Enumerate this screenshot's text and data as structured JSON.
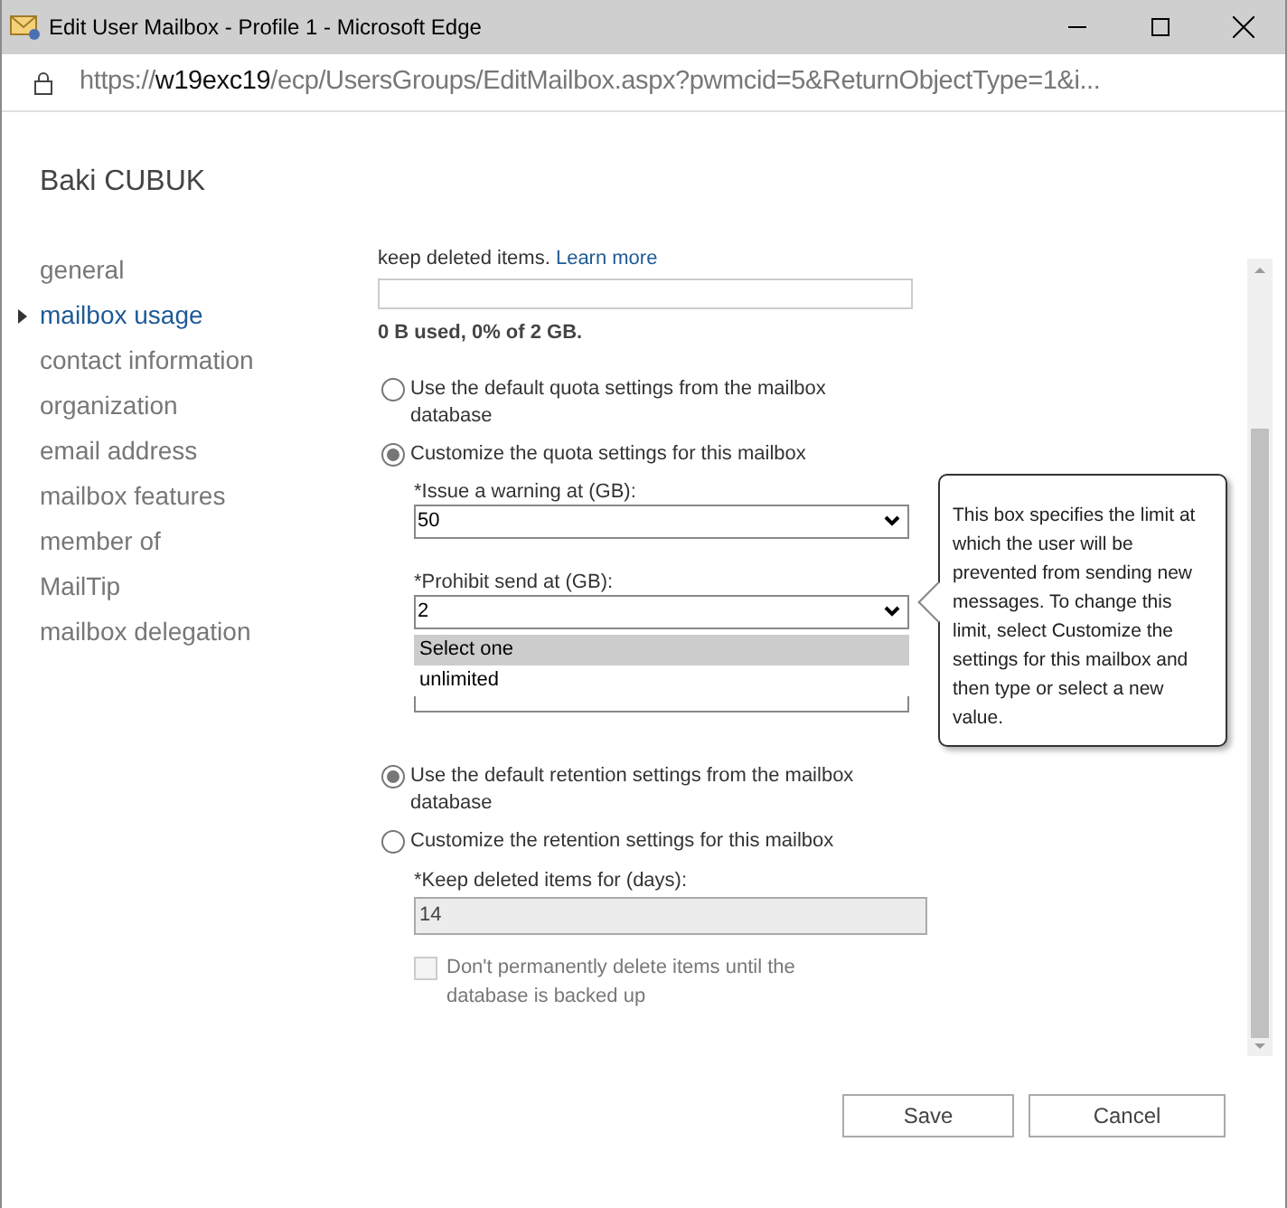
{
  "window": {
    "title": "Edit User Mailbox - Profile 1 - Microsoft Edge"
  },
  "address_bar": {
    "scheme": "https://",
    "host": "w19exc19",
    "path": "/ecp/UsersGroups/EditMailbox.aspx?pwmcid=5&ReturnObjectType=1&i..."
  },
  "user_name": "Baki CUBUK",
  "nav": {
    "items": [
      {
        "label": "general",
        "selected": false
      },
      {
        "label": "mailbox usage",
        "selected": true
      },
      {
        "label": "contact information",
        "selected": false
      },
      {
        "label": "organization",
        "selected": false
      },
      {
        "label": "email address",
        "selected": false
      },
      {
        "label": "mailbox features",
        "selected": false
      },
      {
        "label": "member of",
        "selected": false
      },
      {
        "label": "MailTip",
        "selected": false
      },
      {
        "label": "mailbox delegation",
        "selected": false
      }
    ]
  },
  "content": {
    "intro": "keep deleted items.",
    "learn_more": "Learn more",
    "usage_bar": {
      "level": 0
    },
    "usage_text": "0 B used, 0% of 2 GB.",
    "quota_options": [
      {
        "label": "Use the default quota settings from the mailbox database",
        "selected": false
      },
      {
        "label": "Customize the quota settings for this mailbox",
        "selected": true
      }
    ],
    "warning": {
      "label": "*Issue a warning at (GB):",
      "value": "50"
    },
    "prohibit_send": {
      "label": "*Prohibit send at (GB):",
      "value": "2"
    },
    "dropdown_options": [
      {
        "label": "Select one",
        "selected": true
      },
      {
        "label": "unlimited",
        "selected": false
      }
    ],
    "tooltip": "This box specifies the limit at which the user will be prevented from sending new messages. To change this limit, select Customize the settings for this mailbox and then type or select a new value.",
    "retention_options": [
      {
        "label": "Use the default retention settings from the mailbox database",
        "selected": true
      },
      {
        "label": "Customize the retention settings for this mailbox",
        "selected": false
      }
    ],
    "keep_deleted": {
      "label": "*Keep deleted items for (days):",
      "value": "14",
      "disabled": true
    },
    "backup_checkbox": {
      "label": "Don't permanently delete items until the database is backed up",
      "checked": false,
      "disabled": true
    }
  },
  "buttons": [
    "Save",
    "Cancel"
  ]
}
